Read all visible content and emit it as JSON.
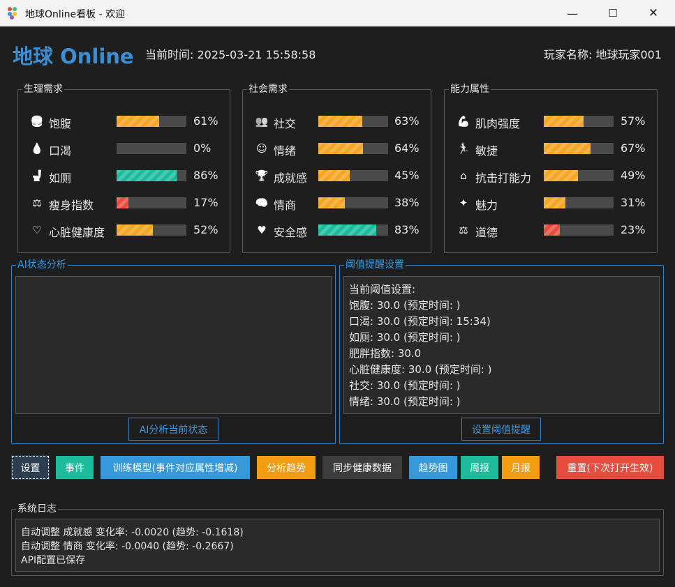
{
  "window": {
    "title": "地球Online看板 - 欢迎",
    "minimize": "—",
    "maximize": "☐",
    "close": "✕"
  },
  "header": {
    "app_title": "地球 Online",
    "current_time": "当前时间: 2025-03-21 15:58:58",
    "player": "玩家名称: 地球玩家001"
  },
  "groups": [
    {
      "title": "生理需求",
      "stats": [
        {
          "icon": "burger-icon",
          "glyph": "🍔",
          "label": "饱腹",
          "pct_text": "61%",
          "value": 61,
          "color": "orange"
        },
        {
          "icon": "droplet-icon",
          "glyph": "💧",
          "label": "口渴",
          "pct_text": "0%",
          "value": 0,
          "color": "orange"
        },
        {
          "icon": "toilet-icon",
          "glyph": "🚽",
          "label": "如厕",
          "pct_text": "86%",
          "value": 86,
          "color": "green"
        },
        {
          "icon": "scale-icon",
          "glyph": "⚖",
          "label": "瘦身指数",
          "pct_text": "17%",
          "value": 17,
          "color": "red"
        },
        {
          "icon": "heart-icon",
          "glyph": "♡",
          "label": "心脏健康度",
          "pct_text": "52%",
          "value": 52,
          "color": "orange"
        }
      ]
    },
    {
      "title": "社会需求",
      "stats": [
        {
          "icon": "people-icon",
          "glyph": "👥",
          "label": "社交",
          "pct_text": "63%",
          "value": 63,
          "color": "orange"
        },
        {
          "icon": "smile-icon",
          "glyph": "☺",
          "label": "情绪",
          "pct_text": "64%",
          "value": 64,
          "color": "orange"
        },
        {
          "icon": "trophy-icon",
          "glyph": "🏆",
          "label": "成就感",
          "pct_text": "45%",
          "value": 45,
          "color": "orange"
        },
        {
          "icon": "brain-icon",
          "glyph": "🧠",
          "label": "情商",
          "pct_text": "38%",
          "value": 38,
          "color": "orange"
        },
        {
          "icon": "shield-heart-icon",
          "glyph": "♥",
          "label": "安全感",
          "pct_text": "83%",
          "value": 83,
          "color": "green"
        }
      ]
    },
    {
      "title": "能力属性",
      "stats": [
        {
          "icon": "muscle-icon",
          "glyph": "💪",
          "label": "肌肉强度",
          "pct_text": "57%",
          "value": 57,
          "color": "orange"
        },
        {
          "icon": "runner-icon",
          "glyph": "🏃",
          "label": "敏捷",
          "pct_text": "67%",
          "value": 67,
          "color": "orange"
        },
        {
          "icon": "house-icon",
          "glyph": "⌂",
          "label": "抗击打能力",
          "pct_text": "49%",
          "value": 49,
          "color": "orange"
        },
        {
          "icon": "sparkle-icon",
          "glyph": "✦",
          "label": "魅力",
          "pct_text": "31%",
          "value": 31,
          "color": "orange"
        },
        {
          "icon": "balance-icon",
          "glyph": "⚖",
          "label": "道德",
          "pct_text": "23%",
          "value": 23,
          "color": "red"
        }
      ]
    }
  ],
  "ai_panel": {
    "title": "AI状态分析",
    "button": "AI分析当前状态"
  },
  "threshold_panel": {
    "title": "阈值提醒设置",
    "lines": [
      "当前阈值设置:",
      "饱腹: 30.0 (预定时间: )",
      "口渴: 30.0 (预定时间: 15:34)",
      "如厕: 30.0 (预定时间: )",
      "肥胖指数: 30.0",
      "心脏健康度: 30.0 (预定时间: )",
      "社交: 30.0 (预定时间: )",
      "情绪: 30.0 (预定时间: )"
    ],
    "button": "设置阈值提醒"
  },
  "toolbar": {
    "settings": "设置",
    "events": "事件",
    "train": "训练模型(事件对应属性增减)",
    "analyze": "分析趋势",
    "sync": "同步健康数据",
    "trend_chart": "趋势图",
    "weekly": "周报",
    "monthly": "月报",
    "reset": "重置(下次打开生效)"
  },
  "colors": {
    "orange": "#f5a623",
    "green": "#1abc9c",
    "red": "#e74c3c",
    "blue": "#3498db",
    "accent": "#3d8fd1"
  },
  "log": {
    "title": "系统日志",
    "lines": [
      "自动调整 成就感 变化率: -0.0020 (趋势: -0.1618)",
      "自动调整 情商 变化率: -0.0040 (趋势: -0.2667)",
      "API配置已保存"
    ]
  }
}
